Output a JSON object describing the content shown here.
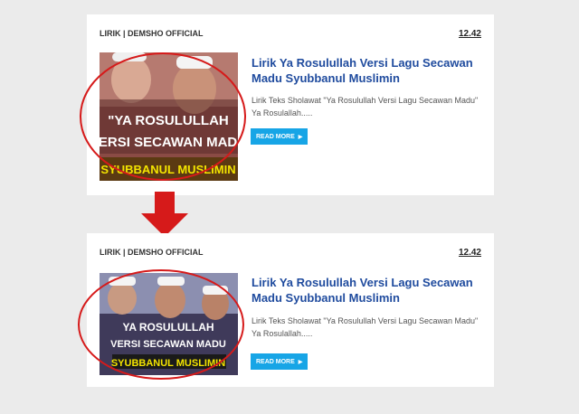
{
  "posts": [
    {
      "category": "LIRIK | DEMSHO OFFICIAL",
      "time": "12.42",
      "title": "Lirik Ya Rosulullah Versi Lagu Secawan Madu Syubbanul Muslimin",
      "excerpt": "Lirik Teks Sholawat \"Ya Rosulullah Versi Lagu Secawan Madu\" Ya Rosulallah.....",
      "read_more": "READ MORE",
      "thumb_lines": [
        "\"YA ROSULULLAH",
        "VERSI SECAWAN MADU",
        "SYUBBANUL MUSLIMIN"
      ]
    },
    {
      "category": "LIRIK | DEMSHO OFFICIAL",
      "time": "12.42",
      "title": "Lirik Ya Rosulullah Versi Lagu Secawan Madu Syubbanul Muslimin",
      "excerpt": "Lirik Teks Sholawat \"Ya Rosulullah Versi Lagu Secawan Madu\" Ya Rosulallah.....",
      "read_more": "READ MORE",
      "thumb_lines": [
        "YA ROSULULLAH",
        "VERSI SECAWAN MADU",
        "SYUBBANUL MUSLIMIN"
      ]
    }
  ],
  "colors": {
    "annotation": "#d61a1a",
    "title": "#1f4b9e",
    "button": "#17a5e6",
    "thumb_highlight": "#f3e400"
  },
  "icons": [
    "chevron-right-icon",
    "down-arrow-icon"
  ]
}
